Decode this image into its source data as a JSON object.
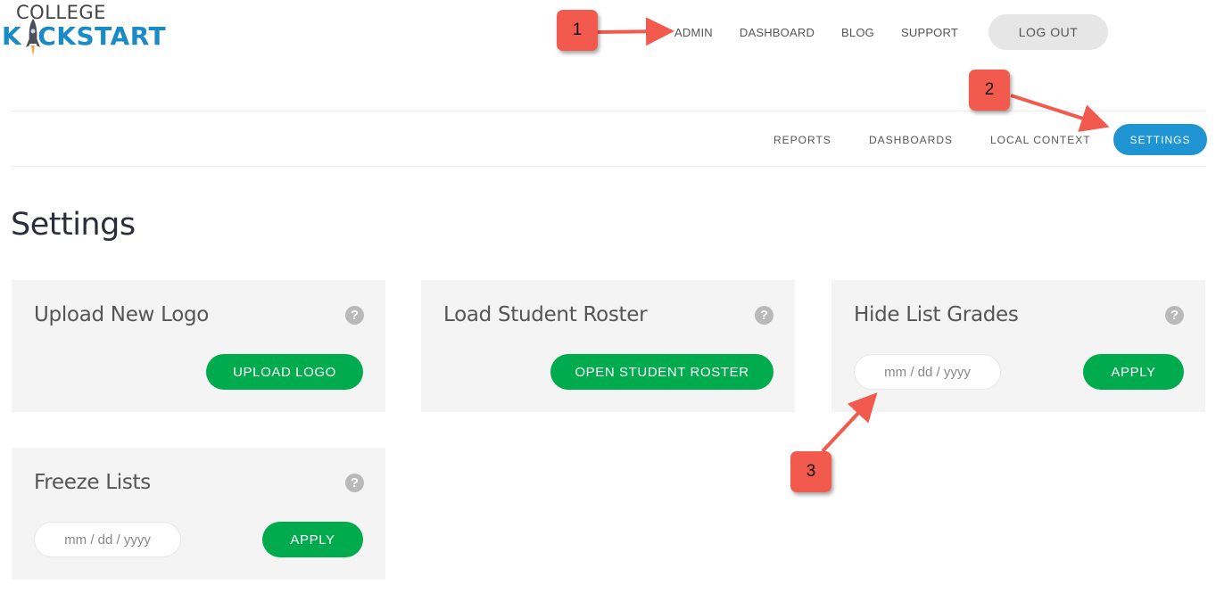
{
  "logo": {
    "line1": "COLLEGE",
    "line2": "KCKSTART"
  },
  "top_nav": {
    "links": [
      "ADMIN",
      "DASHBOARD",
      "BLOG",
      "SUPPORT"
    ],
    "logout": "LOG OUT"
  },
  "sub_nav": {
    "links": [
      "REPORTS",
      "DASHBOARDS",
      "LOCAL CONTEXT"
    ],
    "active": "SETTINGS"
  },
  "page_title": "Settings",
  "cards": {
    "upload_logo": {
      "title": "Upload New Logo",
      "button": "UPLOAD LOGO"
    },
    "student_roster": {
      "title": "Load Student Roster",
      "button": "OPEN STUDENT ROSTER"
    },
    "hide_grades": {
      "title": "Hide List Grades",
      "date_placeholder": "mm / dd / yyyy",
      "button": "APPLY"
    },
    "freeze_lists": {
      "title": "Freeze Lists",
      "date_placeholder": "mm / dd / yyyy",
      "button": "APPLY"
    }
  },
  "help_icon_glyph": "?",
  "annotations": [
    "1",
    "2",
    "3"
  ],
  "colors": {
    "brand_blue": "#1a8bc5",
    "active_tab": "#1e95d2",
    "button_green": "#00ab4e",
    "annotation_red": "#f15a4d"
  }
}
